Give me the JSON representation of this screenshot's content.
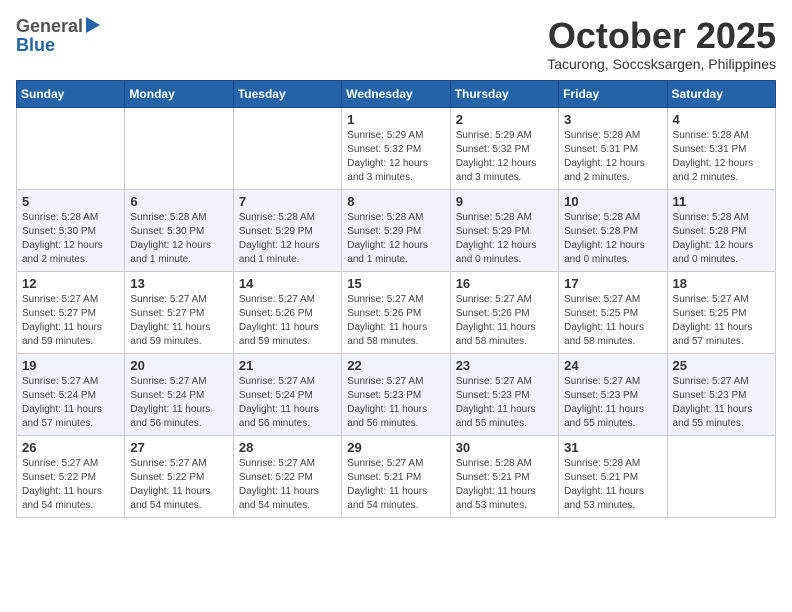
{
  "logo": {
    "general": "General",
    "blue": "Blue"
  },
  "title": "October 2025",
  "subtitle": "Tacurong, Soccsksargen, Philippines",
  "weekdays": [
    "Sunday",
    "Monday",
    "Tuesday",
    "Wednesday",
    "Thursday",
    "Friday",
    "Saturday"
  ],
  "weeks": [
    [
      {
        "day": "",
        "sunrise": "",
        "sunset": "",
        "daylight": ""
      },
      {
        "day": "",
        "sunrise": "",
        "sunset": "",
        "daylight": ""
      },
      {
        "day": "",
        "sunrise": "",
        "sunset": "",
        "daylight": ""
      },
      {
        "day": "1",
        "sunrise": "Sunrise: 5:29 AM",
        "sunset": "Sunset: 5:32 PM",
        "daylight": "Daylight: 12 hours and 3 minutes."
      },
      {
        "day": "2",
        "sunrise": "Sunrise: 5:29 AM",
        "sunset": "Sunset: 5:32 PM",
        "daylight": "Daylight: 12 hours and 3 minutes."
      },
      {
        "day": "3",
        "sunrise": "Sunrise: 5:28 AM",
        "sunset": "Sunset: 5:31 PM",
        "daylight": "Daylight: 12 hours and 2 minutes."
      },
      {
        "day": "4",
        "sunrise": "Sunrise: 5:28 AM",
        "sunset": "Sunset: 5:31 PM",
        "daylight": "Daylight: 12 hours and 2 minutes."
      }
    ],
    [
      {
        "day": "5",
        "sunrise": "Sunrise: 5:28 AM",
        "sunset": "Sunset: 5:30 PM",
        "daylight": "Daylight: 12 hours and 2 minutes."
      },
      {
        "day": "6",
        "sunrise": "Sunrise: 5:28 AM",
        "sunset": "Sunset: 5:30 PM",
        "daylight": "Daylight: 12 hours and 1 minute."
      },
      {
        "day": "7",
        "sunrise": "Sunrise: 5:28 AM",
        "sunset": "Sunset: 5:29 PM",
        "daylight": "Daylight: 12 hours and 1 minute."
      },
      {
        "day": "8",
        "sunrise": "Sunrise: 5:28 AM",
        "sunset": "Sunset: 5:29 PM",
        "daylight": "Daylight: 12 hours and 1 minute."
      },
      {
        "day": "9",
        "sunrise": "Sunrise: 5:28 AM",
        "sunset": "Sunset: 5:29 PM",
        "daylight": "Daylight: 12 hours and 0 minutes."
      },
      {
        "day": "10",
        "sunrise": "Sunrise: 5:28 AM",
        "sunset": "Sunset: 5:28 PM",
        "daylight": "Daylight: 12 hours and 0 minutes."
      },
      {
        "day": "11",
        "sunrise": "Sunrise: 5:28 AM",
        "sunset": "Sunset: 5:28 PM",
        "daylight": "Daylight: 12 hours and 0 minutes."
      }
    ],
    [
      {
        "day": "12",
        "sunrise": "Sunrise: 5:27 AM",
        "sunset": "Sunset: 5:27 PM",
        "daylight": "Daylight: 11 hours and 59 minutes."
      },
      {
        "day": "13",
        "sunrise": "Sunrise: 5:27 AM",
        "sunset": "Sunset: 5:27 PM",
        "daylight": "Daylight: 11 hours and 59 minutes."
      },
      {
        "day": "14",
        "sunrise": "Sunrise: 5:27 AM",
        "sunset": "Sunset: 5:26 PM",
        "daylight": "Daylight: 11 hours and 59 minutes."
      },
      {
        "day": "15",
        "sunrise": "Sunrise: 5:27 AM",
        "sunset": "Sunset: 5:26 PM",
        "daylight": "Daylight: 11 hours and 58 minutes."
      },
      {
        "day": "16",
        "sunrise": "Sunrise: 5:27 AM",
        "sunset": "Sunset: 5:26 PM",
        "daylight": "Daylight: 11 hours and 58 minutes."
      },
      {
        "day": "17",
        "sunrise": "Sunrise: 5:27 AM",
        "sunset": "Sunset: 5:25 PM",
        "daylight": "Daylight: 11 hours and 58 minutes."
      },
      {
        "day": "18",
        "sunrise": "Sunrise: 5:27 AM",
        "sunset": "Sunset: 5:25 PM",
        "daylight": "Daylight: 11 hours and 57 minutes."
      }
    ],
    [
      {
        "day": "19",
        "sunrise": "Sunrise: 5:27 AM",
        "sunset": "Sunset: 5:24 PM",
        "daylight": "Daylight: 11 hours and 57 minutes."
      },
      {
        "day": "20",
        "sunrise": "Sunrise: 5:27 AM",
        "sunset": "Sunset: 5:24 PM",
        "daylight": "Daylight: 11 hours and 56 minutes."
      },
      {
        "day": "21",
        "sunrise": "Sunrise: 5:27 AM",
        "sunset": "Sunset: 5:24 PM",
        "daylight": "Daylight: 11 hours and 56 minutes."
      },
      {
        "day": "22",
        "sunrise": "Sunrise: 5:27 AM",
        "sunset": "Sunset: 5:23 PM",
        "daylight": "Daylight: 11 hours and 56 minutes."
      },
      {
        "day": "23",
        "sunrise": "Sunrise: 5:27 AM",
        "sunset": "Sunset: 5:23 PM",
        "daylight": "Daylight: 11 hours and 55 minutes."
      },
      {
        "day": "24",
        "sunrise": "Sunrise: 5:27 AM",
        "sunset": "Sunset: 5:23 PM",
        "daylight": "Daylight: 11 hours and 55 minutes."
      },
      {
        "day": "25",
        "sunrise": "Sunrise: 5:27 AM",
        "sunset": "Sunset: 5:23 PM",
        "daylight": "Daylight: 11 hours and 55 minutes."
      }
    ],
    [
      {
        "day": "26",
        "sunrise": "Sunrise: 5:27 AM",
        "sunset": "Sunset: 5:22 PM",
        "daylight": "Daylight: 11 hours and 54 minutes."
      },
      {
        "day": "27",
        "sunrise": "Sunrise: 5:27 AM",
        "sunset": "Sunset: 5:22 PM",
        "daylight": "Daylight: 11 hours and 54 minutes."
      },
      {
        "day": "28",
        "sunrise": "Sunrise: 5:27 AM",
        "sunset": "Sunset: 5:22 PM",
        "daylight": "Daylight: 11 hours and 54 minutes."
      },
      {
        "day": "29",
        "sunrise": "Sunrise: 5:27 AM",
        "sunset": "Sunset: 5:21 PM",
        "daylight": "Daylight: 11 hours and 54 minutes."
      },
      {
        "day": "30",
        "sunrise": "Sunrise: 5:28 AM",
        "sunset": "Sunset: 5:21 PM",
        "daylight": "Daylight: 11 hours and 53 minutes."
      },
      {
        "day": "31",
        "sunrise": "Sunrise: 5:28 AM",
        "sunset": "Sunset: 5:21 PM",
        "daylight": "Daylight: 11 hours and 53 minutes."
      },
      {
        "day": "",
        "sunrise": "",
        "sunset": "",
        "daylight": ""
      }
    ]
  ]
}
